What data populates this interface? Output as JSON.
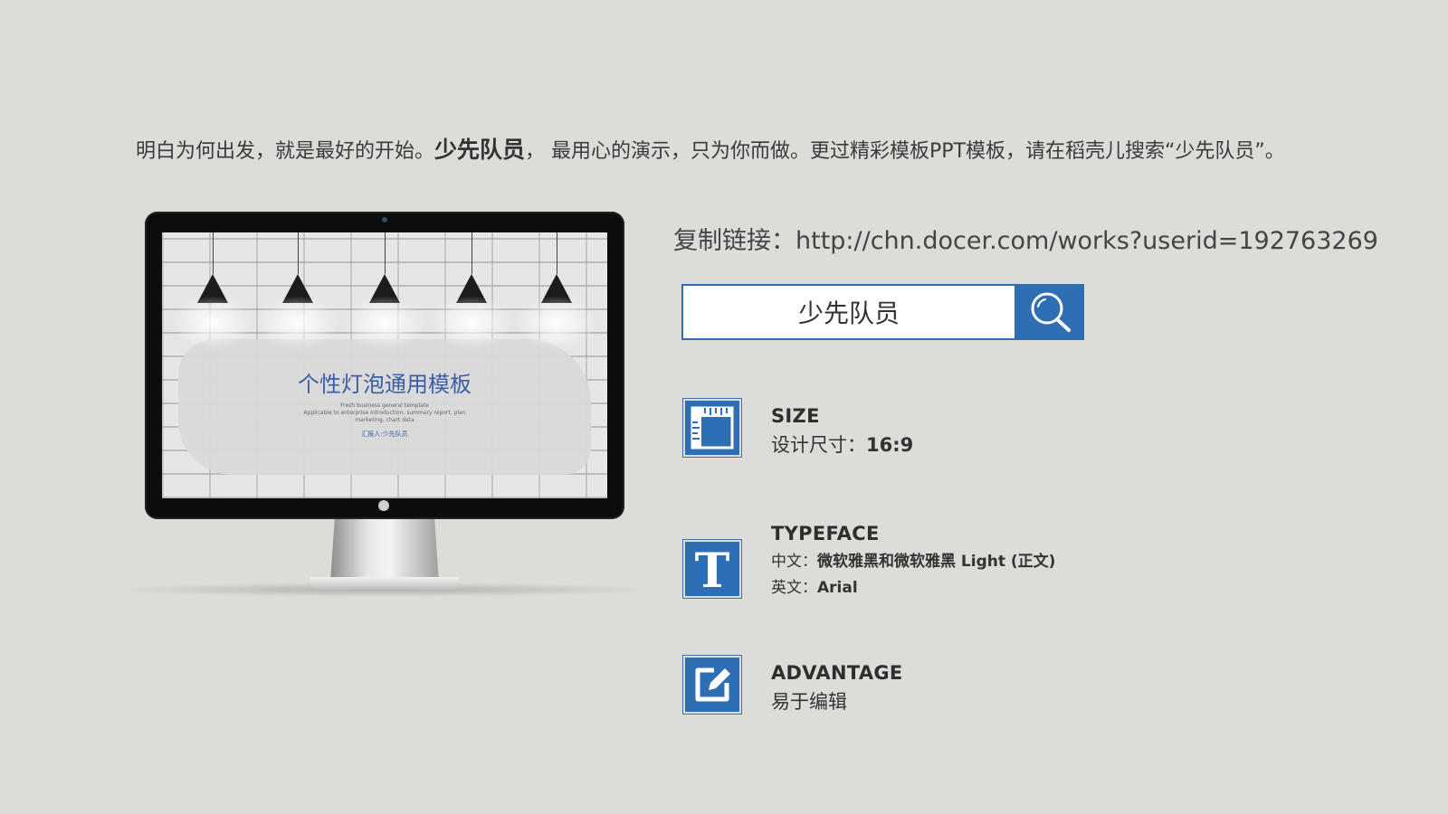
{
  "header": {
    "tagline_part1": "明白为何出发，就是最好的开始。",
    "tagline_bold": "少先队员",
    "tagline_part2": "， 最用心的演示，只为你而做。更过精彩模板PPT模板，请在稻壳儿搜索“少先队员”。"
  },
  "monitor": {
    "screen_title": "个性灯泡通用模板",
    "screen_subtitle_1": "Fresh business general template",
    "screen_subtitle_2": "Applicable to enterprise introduction, summary report, plan",
    "screen_subtitle_3": "marketing, chart data",
    "screen_reporter": "汇报人:少先队员"
  },
  "link": {
    "label": "复制链接：",
    "url": "http://chn.docer.com/works?userid=192763269"
  },
  "search": {
    "value": "少先队员",
    "icon": "search-icon",
    "button_color": "#2e6eb5"
  },
  "features": {
    "size": {
      "icon": "ruler-icon",
      "title": "SIZE",
      "label": "设计尺寸：",
      "value": "16:9"
    },
    "typeface": {
      "icon": "letter-t-icon",
      "title": "TYPEFACE",
      "cn_label": "中文：",
      "cn_value": "微软雅黑和微软雅黑 Light (正文)",
      "en_label": "英文：",
      "en_value": "Arial"
    },
    "advantage": {
      "icon": "edit-icon",
      "title": "ADVANTAGE",
      "value": "易于编辑"
    }
  },
  "colors": {
    "background": "#dcdcd8",
    "accent": "#2e6eb5"
  }
}
